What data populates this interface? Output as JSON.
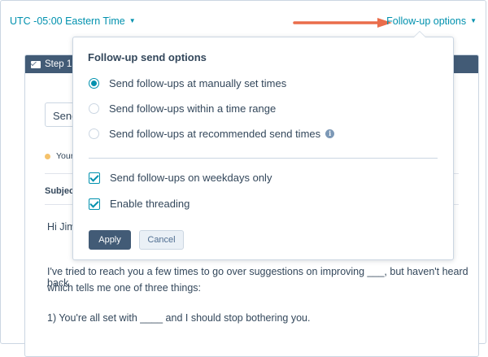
{
  "colors": {
    "accent": "#0091ae",
    "header_dark": "#425b76",
    "arrow": "#ea6d4b",
    "status_dot": "#f5c26b",
    "text": "#33475b",
    "border": "#cbd6e2"
  },
  "topbar": {
    "timezone_label": "UTC -05:00 Eastern Time",
    "followup_label": "Follow-up options"
  },
  "step": {
    "title": "Step 1",
    "send_value": "Send",
    "status_text": "Your",
    "subject_label": "Subject"
  },
  "email_body": {
    "greeting": "Hi Jim",
    "line1": "I've tried to reach you a few times to go over suggestions on improving ___, but haven't heard back",
    "line2": "which tells me one of three things:",
    "line3": "1) You're all set with ____ and I should stop bothering you."
  },
  "popover": {
    "title": "Follow-up send options",
    "radio_options": [
      {
        "label": "Send follow-ups at manually set times",
        "selected": true
      },
      {
        "label": "Send follow-ups within a time range",
        "selected": false
      },
      {
        "label": "Send follow-ups at recommended send times",
        "selected": false
      }
    ],
    "checkboxes": [
      {
        "label": "Send follow-ups on weekdays only",
        "checked": true
      },
      {
        "label": "Enable threading",
        "checked": true
      }
    ],
    "apply_label": "Apply",
    "cancel_label": "Cancel"
  },
  "icons": {
    "info_glyph": "i",
    "caret_glyph": "▼"
  }
}
